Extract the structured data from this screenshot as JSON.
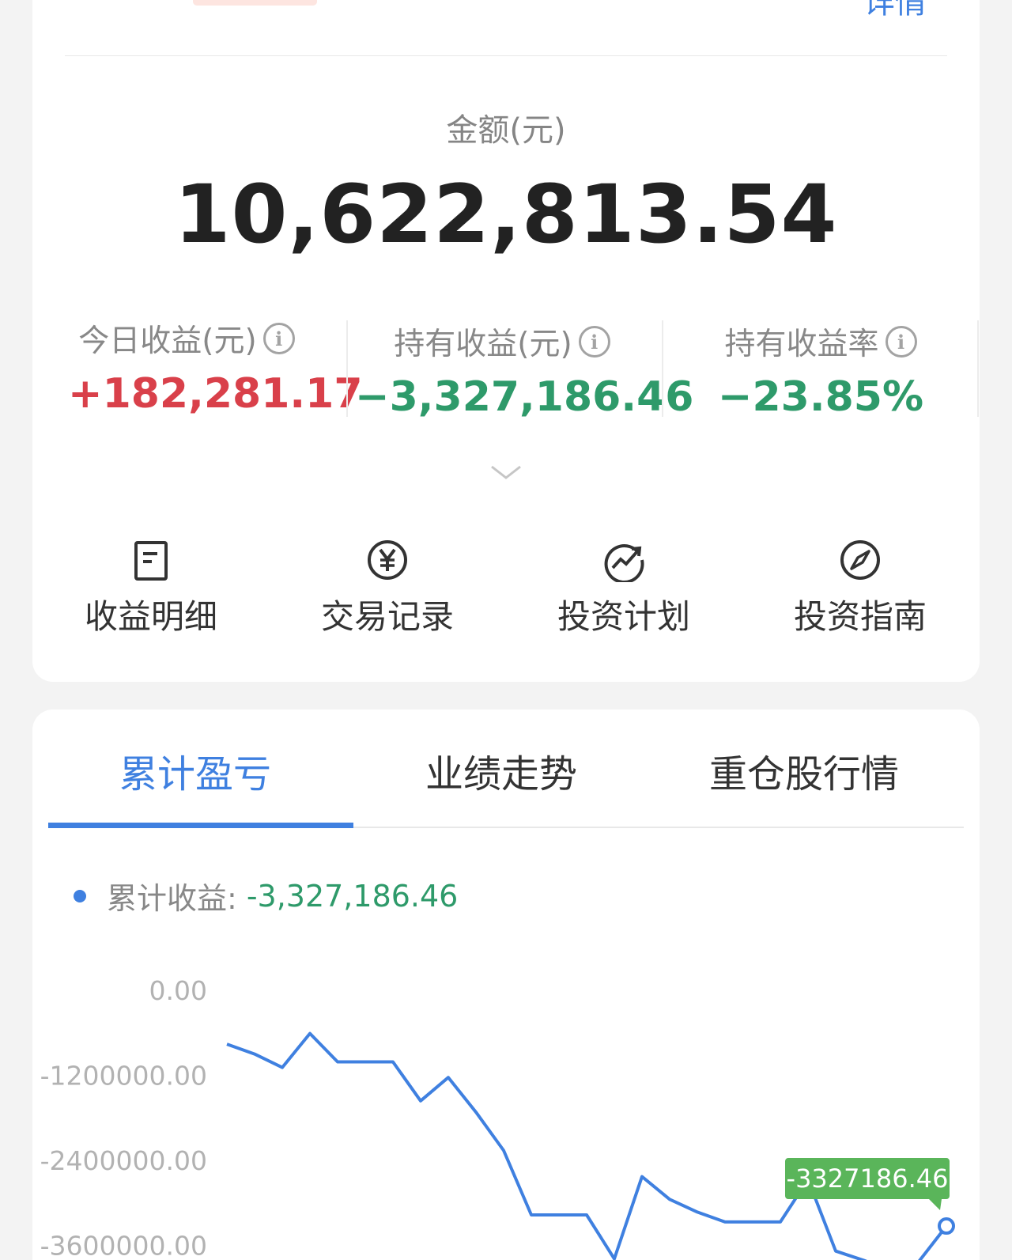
{
  "header": {
    "link_partial": "详情",
    "amount_label": "金额(元)",
    "amount_value": "10,622,813.54"
  },
  "stats": [
    {
      "label": "今日收益(元)",
      "value": "+182,281.17",
      "tone": "red"
    },
    {
      "label": "持有收益(元)",
      "value": "−3,327,186.46",
      "tone": "green"
    },
    {
      "label": "持有收益率",
      "value": "−23.85%",
      "tone": "green"
    }
  ],
  "actions": [
    {
      "label": "收益明细",
      "icon": "document-icon"
    },
    {
      "label": "交易记录",
      "icon": "yen-circle-icon"
    },
    {
      "label": "投资计划",
      "icon": "trend-circle-icon"
    },
    {
      "label": "投资指南",
      "icon": "compass-icon"
    }
  ],
  "tabs": [
    {
      "label": "累计盈亏",
      "active": true
    },
    {
      "label": "业绩走势",
      "active": false
    },
    {
      "label": "重仓股行情",
      "active": false
    }
  ],
  "legend": {
    "label": "累计收益:",
    "value": "-3,327,186.46"
  },
  "colors": {
    "accent": "#3f80e0",
    "gain": "#d9404a",
    "loss": "#2e9a6a",
    "tooltip": "#5ab55a"
  },
  "chart_data": {
    "type": "line",
    "y_tick_labels": [
      "0.00",
      "-1200000.00",
      "-2400000.00",
      "-3600000.00"
    ],
    "y_ticks": [
      0,
      -1200000,
      -2400000,
      -3600000
    ],
    "series": [
      {
        "values": [
          -760000,
          -900000,
          -1090000,
          -610000,
          -1010000,
          -1010000,
          -1010000,
          -1560000,
          -1230000,
          -1720000,
          -2260000,
          -3170000,
          -3170000,
          -3170000,
          -3790000,
          -2630000,
          -2950000,
          -3130000,
          -3270000,
          -3270000,
          -3270000,
          -2670000,
          -3680000,
          -3810000,
          -3950000,
          -3830000,
          -3327186.46
        ]
      }
    ],
    "tooltip": "-3327186.46"
  }
}
